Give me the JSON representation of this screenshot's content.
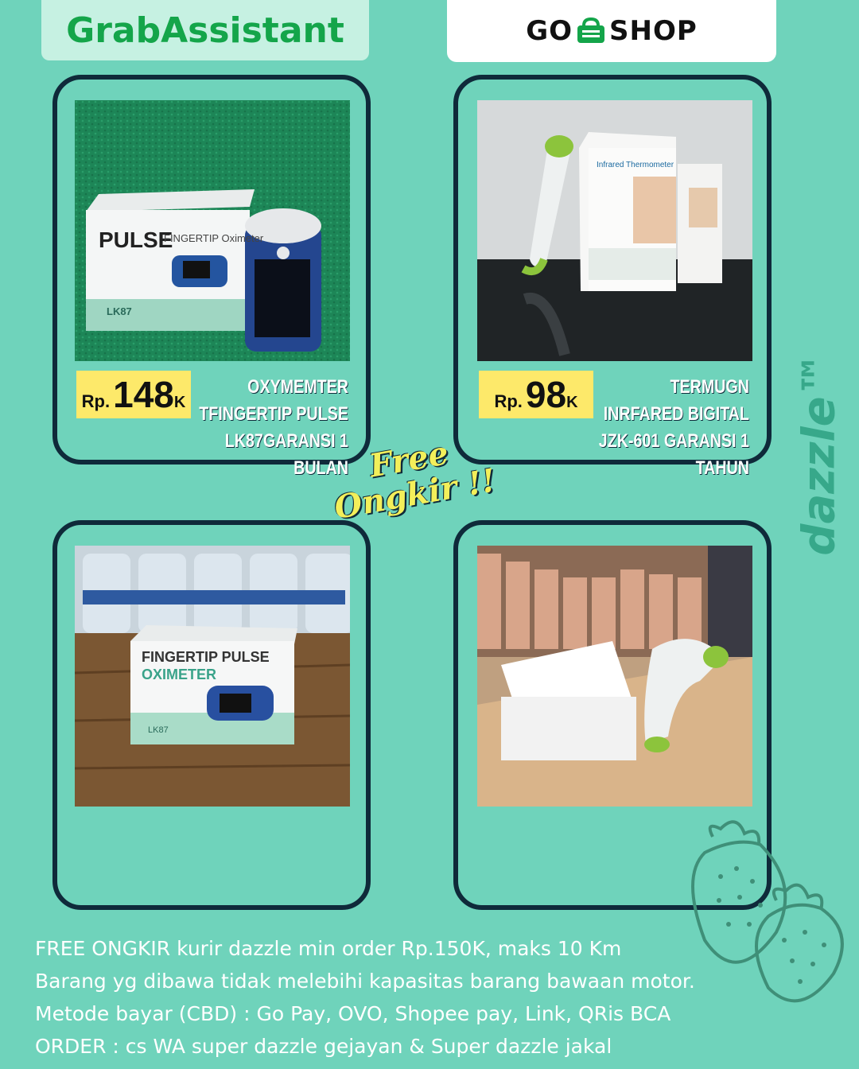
{
  "header": {
    "grab_logo": "GrabAssistant",
    "goshop_left": "GO",
    "goshop_right": "SHOP"
  },
  "products": [
    {
      "price_prefix": "Rp.",
      "price_value": "148",
      "price_suffix": "K",
      "title_lines": [
        "OXYMEMTER",
        "TFINGERTIP PULSE",
        "LK87GARANSI 1 BULAN"
      ],
      "photo_text": {
        "line1": "PULSE",
        "line2": "FINGERTIP Oximeter",
        "line3": "LK87"
      }
    },
    {
      "price_prefix": "Rp.",
      "price_value": "98",
      "price_suffix": "K",
      "title_lines": [
        "TERMUGN",
        "INRFARED BIGITAL",
        "JZK-601 GARANSI 1 TAHUN"
      ],
      "photo_text": {
        "line1": "Infrared Thermometer"
      }
    },
    {
      "photo_text": {
        "line1": "FINGERTIP PULSE",
        "line2": "OXIMETER",
        "line3": "LK87"
      }
    },
    {
      "photo_text": {}
    }
  ],
  "badge": {
    "line1": "Free",
    "line2": "Ongkir !!"
  },
  "brand": "dazzle™",
  "footer_lines": [
    "FREE ONGKIR kurir dazzle min order Rp.150K, maks 10 Km",
    "Barang yg dibawa tidak melebihi kapasitas barang bawaan motor.",
    "Metode bayar (CBD) : Go Pay, OVO, Shopee pay, Link, QRis BCA",
    "ORDER : cs WA super dazzle gejayan & Super dazzle jakal"
  ],
  "colors": {
    "background": "#6fd3bb",
    "card_border": "#0f2a3a",
    "price_box": "#fde96a",
    "grab_green": "#14a54a",
    "badge_yellow": "#f3ef5a"
  }
}
